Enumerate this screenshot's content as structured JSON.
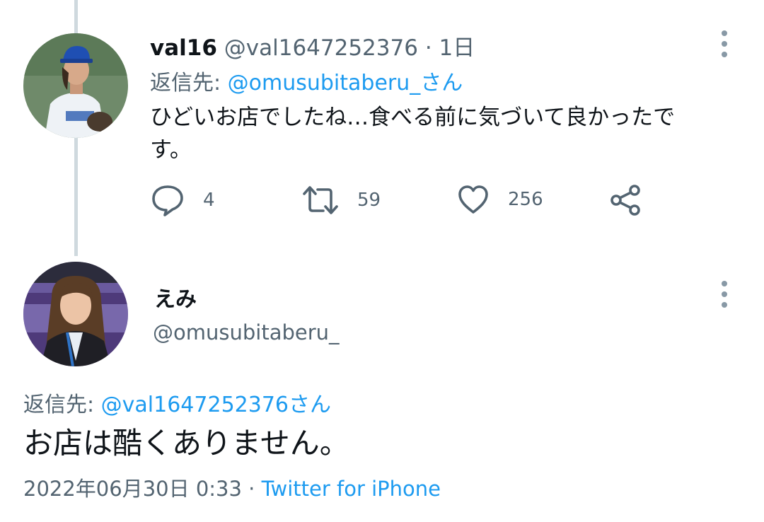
{
  "tweet1": {
    "display_name": "val16",
    "handle": "@val1647252376",
    "separator": "·",
    "time": "1日",
    "reply_prefix": "返信先: ",
    "reply_mention": "@omusubitaberu_さん",
    "body": "ひどいお店でしたね…食べる前に気づいて良かったです。",
    "replies": "4",
    "retweets": "59",
    "likes": "256"
  },
  "tweet2": {
    "display_name": "えみ",
    "handle": "@omusubitaberu_",
    "reply_prefix": "返信先: ",
    "reply_mention": "@val1647252376さん",
    "body": "お店は酷くありません。",
    "timestamp": "2022年06月30日 0:33",
    "separator": "·",
    "source": "Twitter for iPhone"
  },
  "colors": {
    "text": "#0f1419",
    "secondary": "#536471",
    "accent": "#1d9bf0",
    "thread_line": "#cfd9de"
  },
  "icons": {
    "reply": "speech-bubble-icon",
    "retweet": "retweet-arrows-icon",
    "like": "heart-icon",
    "share": "share-nodes-icon",
    "more": "vertical-dots-icon"
  }
}
